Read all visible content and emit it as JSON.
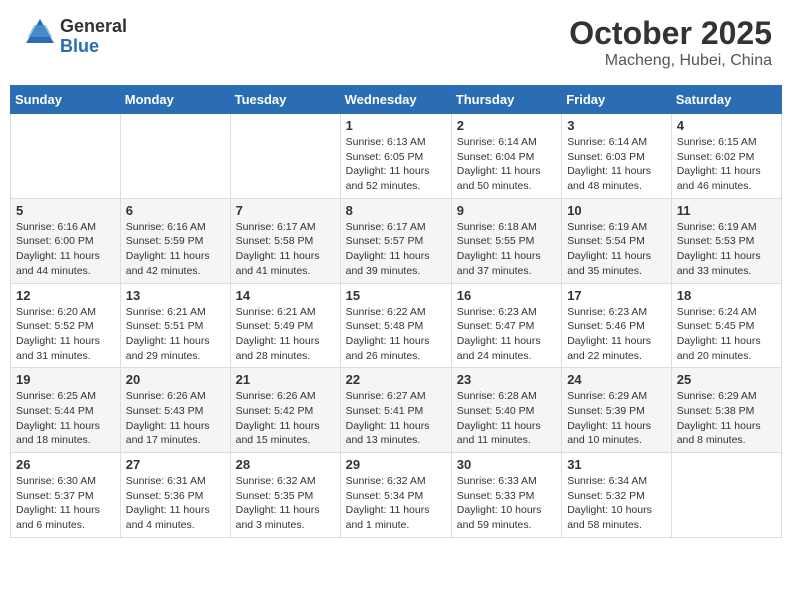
{
  "header": {
    "logo_line1": "General",
    "logo_line2": "Blue",
    "month": "October 2025",
    "location": "Macheng, Hubei, China"
  },
  "weekdays": [
    "Sunday",
    "Monday",
    "Tuesday",
    "Wednesday",
    "Thursday",
    "Friday",
    "Saturday"
  ],
  "weeks": [
    [
      {
        "day": "",
        "info": ""
      },
      {
        "day": "",
        "info": ""
      },
      {
        "day": "",
        "info": ""
      },
      {
        "day": "1",
        "info": "Sunrise: 6:13 AM\nSunset: 6:05 PM\nDaylight: 11 hours and 52 minutes."
      },
      {
        "day": "2",
        "info": "Sunrise: 6:14 AM\nSunset: 6:04 PM\nDaylight: 11 hours and 50 minutes."
      },
      {
        "day": "3",
        "info": "Sunrise: 6:14 AM\nSunset: 6:03 PM\nDaylight: 11 hours and 48 minutes."
      },
      {
        "day": "4",
        "info": "Sunrise: 6:15 AM\nSunset: 6:02 PM\nDaylight: 11 hours and 46 minutes."
      }
    ],
    [
      {
        "day": "5",
        "info": "Sunrise: 6:16 AM\nSunset: 6:00 PM\nDaylight: 11 hours and 44 minutes."
      },
      {
        "day": "6",
        "info": "Sunrise: 6:16 AM\nSunset: 5:59 PM\nDaylight: 11 hours and 42 minutes."
      },
      {
        "day": "7",
        "info": "Sunrise: 6:17 AM\nSunset: 5:58 PM\nDaylight: 11 hours and 41 minutes."
      },
      {
        "day": "8",
        "info": "Sunrise: 6:17 AM\nSunset: 5:57 PM\nDaylight: 11 hours and 39 minutes."
      },
      {
        "day": "9",
        "info": "Sunrise: 6:18 AM\nSunset: 5:55 PM\nDaylight: 11 hours and 37 minutes."
      },
      {
        "day": "10",
        "info": "Sunrise: 6:19 AM\nSunset: 5:54 PM\nDaylight: 11 hours and 35 minutes."
      },
      {
        "day": "11",
        "info": "Sunrise: 6:19 AM\nSunset: 5:53 PM\nDaylight: 11 hours and 33 minutes."
      }
    ],
    [
      {
        "day": "12",
        "info": "Sunrise: 6:20 AM\nSunset: 5:52 PM\nDaylight: 11 hours and 31 minutes."
      },
      {
        "day": "13",
        "info": "Sunrise: 6:21 AM\nSunset: 5:51 PM\nDaylight: 11 hours and 29 minutes."
      },
      {
        "day": "14",
        "info": "Sunrise: 6:21 AM\nSunset: 5:49 PM\nDaylight: 11 hours and 28 minutes."
      },
      {
        "day": "15",
        "info": "Sunrise: 6:22 AM\nSunset: 5:48 PM\nDaylight: 11 hours and 26 minutes."
      },
      {
        "day": "16",
        "info": "Sunrise: 6:23 AM\nSunset: 5:47 PM\nDaylight: 11 hours and 24 minutes."
      },
      {
        "day": "17",
        "info": "Sunrise: 6:23 AM\nSunset: 5:46 PM\nDaylight: 11 hours and 22 minutes."
      },
      {
        "day": "18",
        "info": "Sunrise: 6:24 AM\nSunset: 5:45 PM\nDaylight: 11 hours and 20 minutes."
      }
    ],
    [
      {
        "day": "19",
        "info": "Sunrise: 6:25 AM\nSunset: 5:44 PM\nDaylight: 11 hours and 18 minutes."
      },
      {
        "day": "20",
        "info": "Sunrise: 6:26 AM\nSunset: 5:43 PM\nDaylight: 11 hours and 17 minutes."
      },
      {
        "day": "21",
        "info": "Sunrise: 6:26 AM\nSunset: 5:42 PM\nDaylight: 11 hours and 15 minutes."
      },
      {
        "day": "22",
        "info": "Sunrise: 6:27 AM\nSunset: 5:41 PM\nDaylight: 11 hours and 13 minutes."
      },
      {
        "day": "23",
        "info": "Sunrise: 6:28 AM\nSunset: 5:40 PM\nDaylight: 11 hours and 11 minutes."
      },
      {
        "day": "24",
        "info": "Sunrise: 6:29 AM\nSunset: 5:39 PM\nDaylight: 11 hours and 10 minutes."
      },
      {
        "day": "25",
        "info": "Sunrise: 6:29 AM\nSunset: 5:38 PM\nDaylight: 11 hours and 8 minutes."
      }
    ],
    [
      {
        "day": "26",
        "info": "Sunrise: 6:30 AM\nSunset: 5:37 PM\nDaylight: 11 hours and 6 minutes."
      },
      {
        "day": "27",
        "info": "Sunrise: 6:31 AM\nSunset: 5:36 PM\nDaylight: 11 hours and 4 minutes."
      },
      {
        "day": "28",
        "info": "Sunrise: 6:32 AM\nSunset: 5:35 PM\nDaylight: 11 hours and 3 minutes."
      },
      {
        "day": "29",
        "info": "Sunrise: 6:32 AM\nSunset: 5:34 PM\nDaylight: 11 hours and 1 minute."
      },
      {
        "day": "30",
        "info": "Sunrise: 6:33 AM\nSunset: 5:33 PM\nDaylight: 10 hours and 59 minutes."
      },
      {
        "day": "31",
        "info": "Sunrise: 6:34 AM\nSunset: 5:32 PM\nDaylight: 10 hours and 58 minutes."
      },
      {
        "day": "",
        "info": ""
      }
    ]
  ]
}
